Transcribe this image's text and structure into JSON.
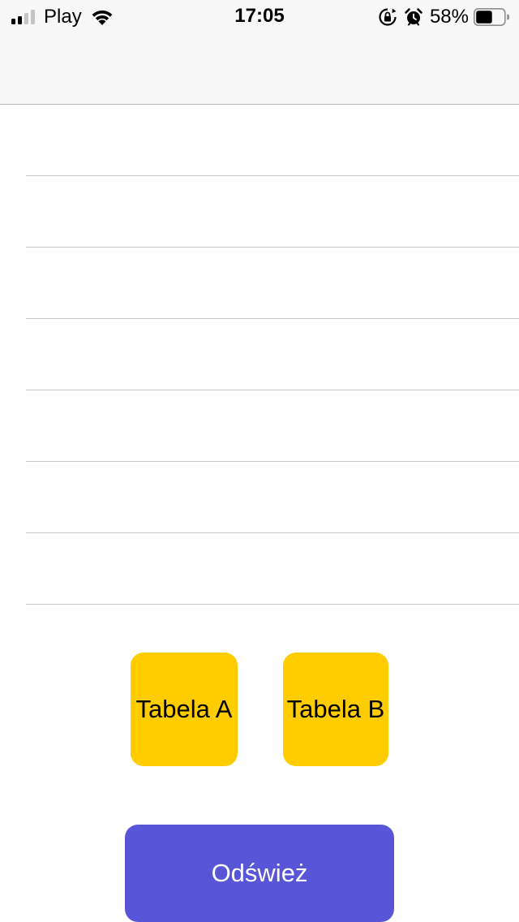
{
  "status_bar": {
    "carrier": "Play",
    "time": "17:05",
    "battery_percent": "58%",
    "battery_level": 0.58,
    "signal_bars_active": 2,
    "signal_bars_total": 4,
    "icons": [
      "cellular-signal-icon",
      "wifi-icon",
      "orientation-lock-icon",
      "alarm-icon",
      "battery-icon"
    ]
  },
  "list": {
    "row_count": 7,
    "rows": [
      "",
      "",
      "",
      "",
      "",
      "",
      ""
    ]
  },
  "buttons": {
    "table_a_label": "Tabela A",
    "table_b_label": "Tabela B",
    "refresh_label": "Odśwież"
  },
  "colors": {
    "table_button_bg": "#ffcc00",
    "refresh_button_bg": "#5856d6",
    "refresh_button_text": "#ffffff",
    "nav_bg": "#f7f7f7",
    "separator": "#c8c7cc"
  }
}
